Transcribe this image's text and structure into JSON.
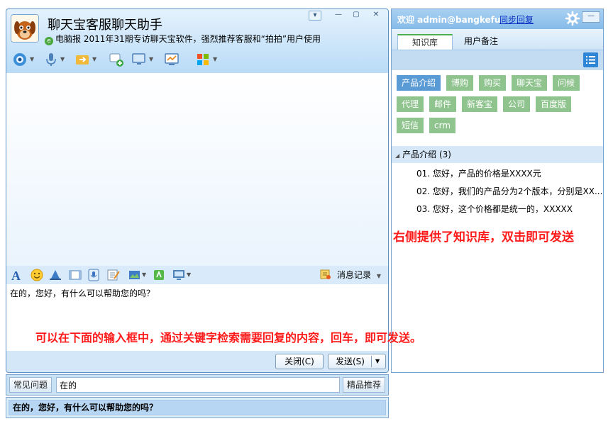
{
  "chat": {
    "title": "聊天宝客服聊天助手",
    "news": "电脑报 2011年31期专访聊天宝软件，强烈推荐客服和“拍拍”用户使用",
    "window_buttons": [
      "▾",
      "—",
      "▢",
      "✕"
    ],
    "history_label": "消息记录",
    "input_text": "在的，您好，有什么可以帮助您的吗？",
    "close_label": "关闭(C)",
    "send_label": "发送(S)"
  },
  "search": {
    "faq_label": "常见问题",
    "query": "在的",
    "recommend_label": "精品推荐",
    "suggestion": "在的，您好，有什么可以帮助您的吗？"
  },
  "panel": {
    "welcome": "欢迎 admin@bangkefu",
    "sync_label": "同步回复",
    "tabs": [
      "知识库",
      "用户备注"
    ],
    "tags": [
      "产品介绍",
      "博购",
      "购买",
      "聊天宝",
      "问候",
      "代理",
      "邮件",
      "新客宝",
      "公司",
      "百度版",
      "短信",
      "crm"
    ],
    "group_title": "产品介绍 (3)",
    "items": [
      "01. 您好，产品的价格是XXXX元",
      "02. 您好，我们的产品分为2个版本，分别是XX...",
      "03. 您好，这个价格都是统一的，XXXXX"
    ]
  },
  "annotations": {
    "right": "右侧提供了知识库，双击即可发送",
    "bottom": "可以在下面的输入框中，通过关键字检索需要回复的内容，回车，即可发送。"
  },
  "colors": {
    "accent": "#5b9bd5",
    "tag": "#8fc48f",
    "annotation": "#ff1a1a"
  },
  "icons": {
    "toolbar_top": [
      "camera-icon",
      "microphone-icon",
      "file-transfer-icon",
      "add-contact-icon",
      "remote-screen-icon",
      "screen-share-icon",
      "apps-icon"
    ],
    "toolbar_format": [
      "font-icon",
      "emoji-icon",
      "hat-icon",
      "video-icon",
      "voice-icon",
      "note-icon",
      "screenshot-icon",
      "gift-icon",
      "monitor-icon"
    ]
  }
}
